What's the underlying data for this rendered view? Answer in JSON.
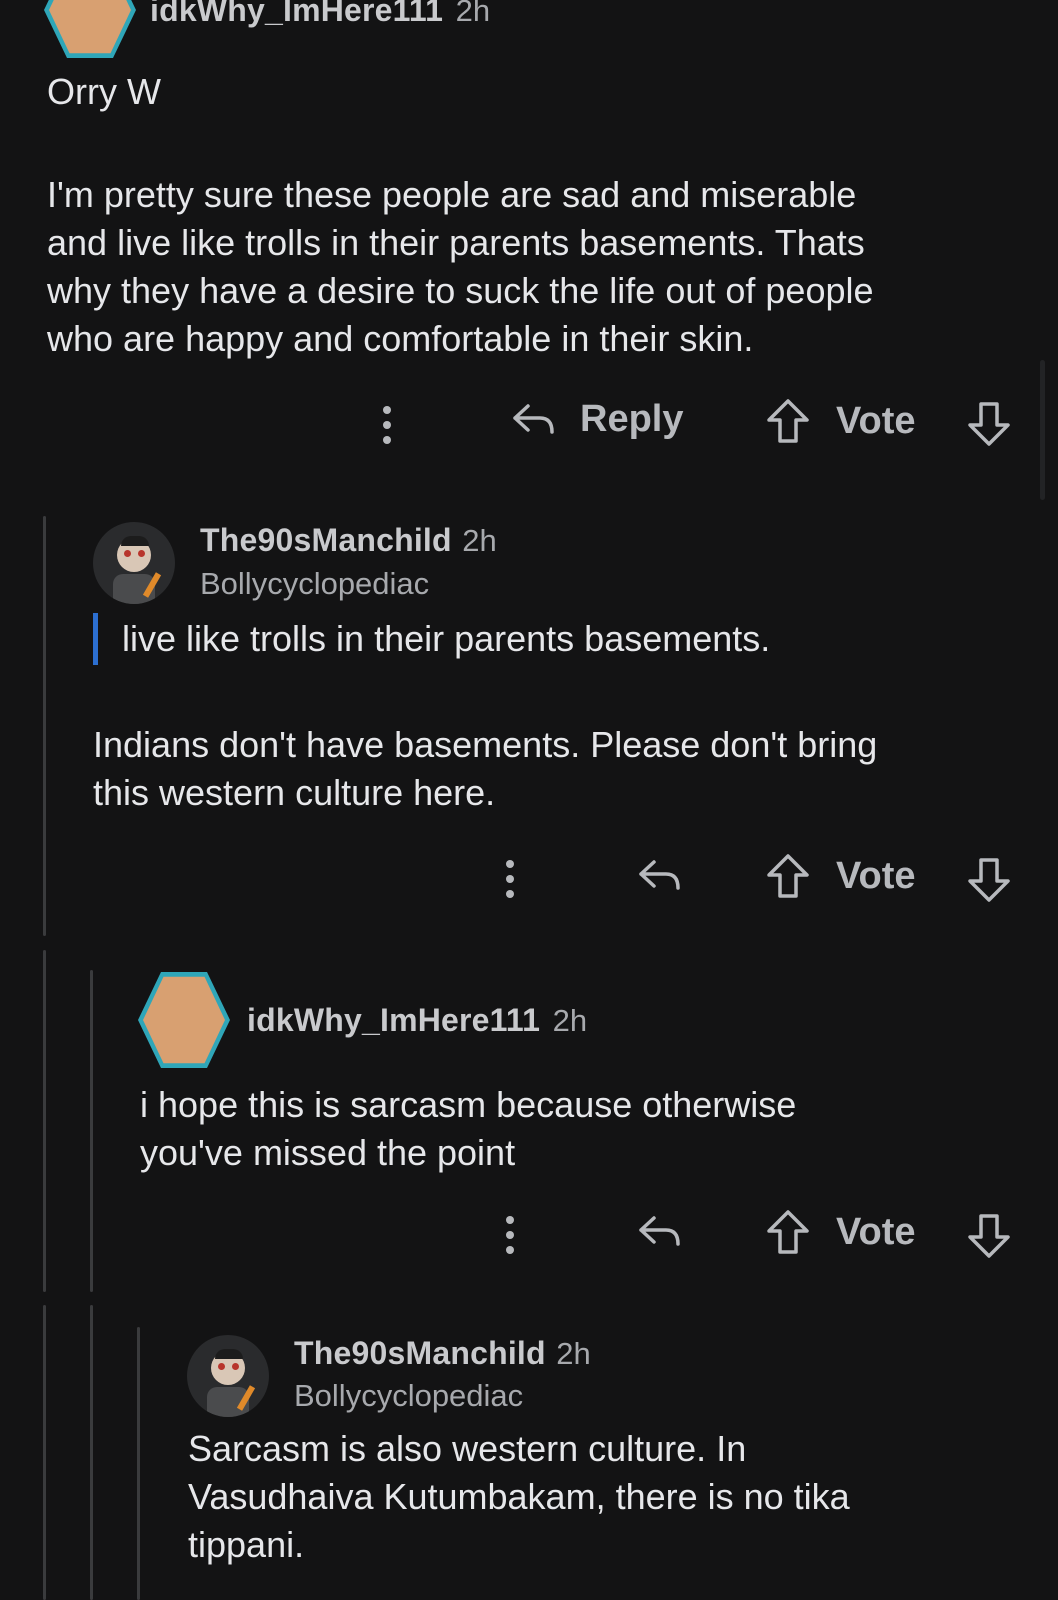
{
  "comments": [
    {
      "username": "idkWhy_ImHere111",
      "time": "2h",
      "lines": [
        "Orry W",
        "",
        "I'm pretty sure these people are sad and miserable",
        "and live like trolls in their parents basements. Thats",
        "why they have a desire to suck the life out of people",
        "who are happy and comfortable in their skin."
      ],
      "reply_label": "Reply",
      "vote_label": "Vote"
    },
    {
      "username": "The90sManchild",
      "time": "2h",
      "flair": "Bollycyclopediac",
      "quote": "live like trolls in their parents basements.",
      "lines": [
        "Indians don't have basements. Please don't bring",
        "this western culture here."
      ],
      "vote_label": "Vote"
    },
    {
      "username": "idkWhy_ImHere111",
      "time": "2h",
      "lines": [
        "i hope this is sarcasm because otherwise",
        "you've missed the point"
      ],
      "vote_label": "Vote"
    },
    {
      "username": "The90sManchild",
      "time": "2h",
      "flair": "Bollycyclopediac",
      "lines": [
        "Sarcasm is also western culture. In",
        "Vasudhaiva Kutumbakam, there is no tika",
        "tippani."
      ]
    }
  ],
  "icons": {
    "more": "more-options-icon",
    "reply": "reply-arrow-icon",
    "upvote": "upvote-arrow-icon",
    "downvote": "downvote-arrow-icon"
  },
  "colors": {
    "background": "#131314",
    "quote_bar": "#2c6fd1",
    "thread_line": "#3a3b3d"
  }
}
